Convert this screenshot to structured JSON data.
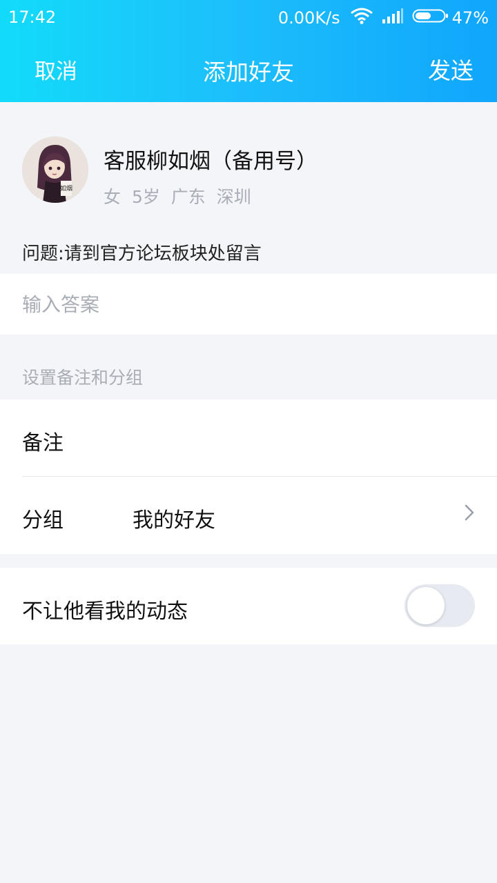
{
  "status_bar": {
    "time": "17:42",
    "network_speed": "0.00K/s",
    "wifi_icon": "wifi-icon",
    "signal_icon": "signal-icon",
    "battery_icon": "battery-icon",
    "battery_percent": "47%"
  },
  "nav": {
    "cancel": "取消",
    "title": "添加好友",
    "send": "发送"
  },
  "profile": {
    "name": "客服柳如烟（备用号）",
    "info": "女 5岁 广东 深圳",
    "avatar_text": "如烟"
  },
  "question": "问题:请到官方论坛板块处留言",
  "answer": {
    "value": "",
    "placeholder": "输入答案"
  },
  "section_label": "设置备注和分组",
  "remark": {
    "label": "备注"
  },
  "group": {
    "label": "分组",
    "value": "我的好友"
  },
  "privacy": {
    "label": "不让他看我的动态",
    "enabled": false
  },
  "colors": {
    "header_gradient_start": "#12dbfa",
    "header_gradient_end": "#10a6fc",
    "page_background": "#f4f5f9",
    "hint_text": "#a9adb5"
  }
}
